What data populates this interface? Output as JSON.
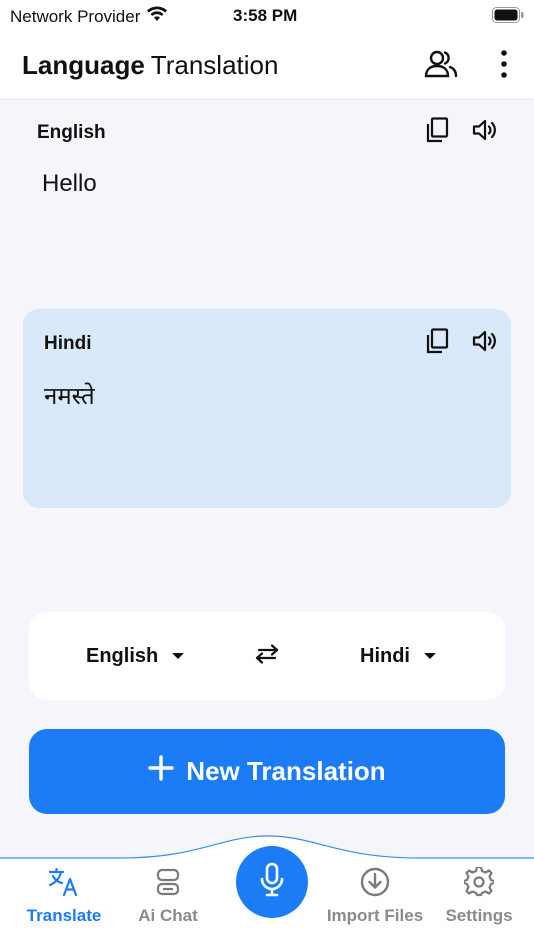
{
  "status_bar": {
    "carrier": "Network Provider",
    "time": "3:58 PM"
  },
  "header": {
    "title_bold": "Language",
    "title_light": "Translation"
  },
  "source": {
    "language": "English",
    "text": "Hello"
  },
  "target": {
    "language": "Hindi",
    "text": "नमस्ते"
  },
  "selector": {
    "from": "English",
    "to": "Hindi"
  },
  "new_translation_label": "New Translation",
  "nav": {
    "items": [
      {
        "label": "Translate",
        "icon": "translate-icon",
        "active": true
      },
      {
        "label": "Ai Chat",
        "icon": "robot-icon",
        "active": false
      },
      {
        "label": "Import Files",
        "icon": "download-icon",
        "active": false
      },
      {
        "label": "Settings",
        "icon": "gear-icon",
        "active": false
      }
    ]
  },
  "colors": {
    "accent": "#1b7cf6",
    "target_panel_bg": "#dae9f9",
    "background": "#f4f6fb",
    "inactive_nav": "#8a8a8a"
  }
}
